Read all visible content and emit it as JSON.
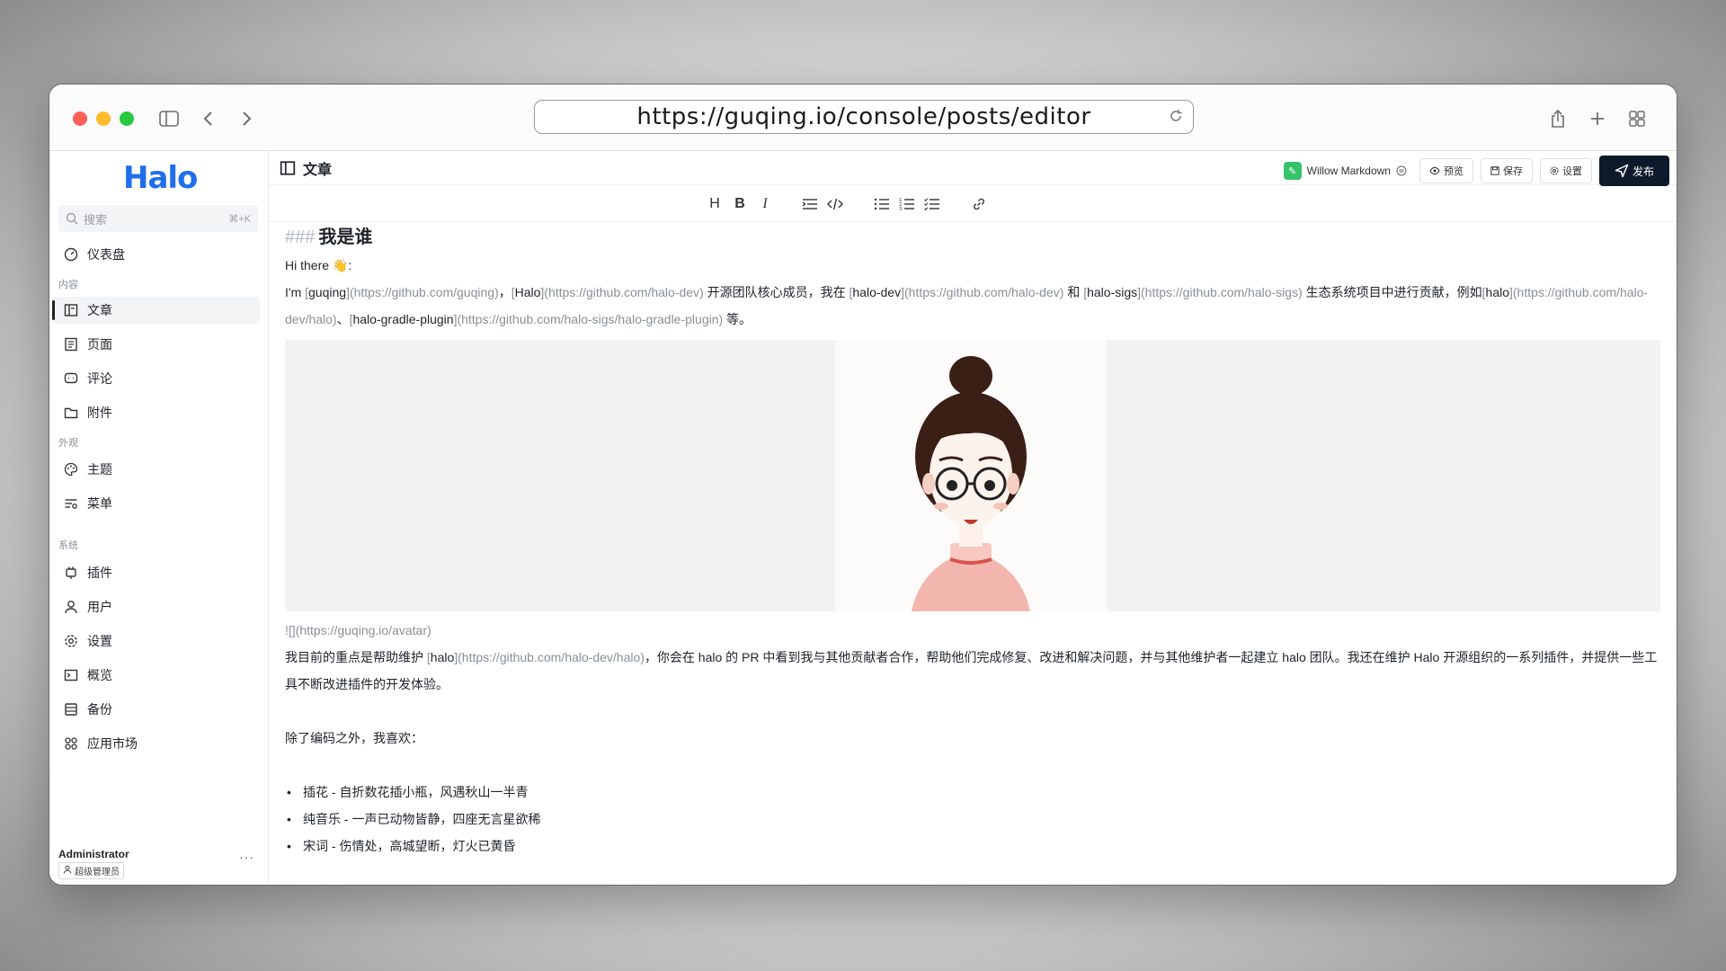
{
  "browser": {
    "url": "https://guqing.io/console/posts/editor"
  },
  "sidebar": {
    "logo": "Halo",
    "search": {
      "placeholder": "搜索",
      "shortcut": "⌘+K"
    },
    "dashboard": "仪表盘",
    "groups": {
      "content": "内容",
      "appearance": "外观",
      "system": "系统"
    },
    "items": {
      "posts": "文章",
      "pages": "页面",
      "comments": "评论",
      "attachments": "附件",
      "themes": "主题",
      "menus": "菜单",
      "plugins": "插件",
      "users": "用户",
      "settings": "设置",
      "overview": "概览",
      "backup": "备份",
      "appstore": "应用市场"
    },
    "user": {
      "name": "Administrator",
      "role": "超级管理员"
    }
  },
  "header": {
    "title": "文章",
    "editor_name": "Willow Markdown",
    "preview": "预览",
    "save": "保存",
    "settings": "设置",
    "publish": "发布"
  },
  "toolbar": {
    "heading": "H",
    "bold": "B",
    "italic": "I"
  },
  "document": {
    "h3_marker": "###",
    "h3_text": "我是谁",
    "greeting": "Hi there 👋:",
    "intro": {
      "p1": "I'm ",
      "guqing": "guqing",
      "guqing_url": "(https://github.com/guqing)",
      "sep1": "，",
      "halo": "Halo",
      "halo_url": "(https://github.com/halo-dev)",
      "p2": " 开源团队核心成员，我在 ",
      "halodev": "halo-dev",
      "halodev_url": "(https://github.com/halo-dev)",
      "p3": " 和 ",
      "halosigs": "halo-sigs",
      "halosigs_url": "(https://github.com/halo-sigs)",
      "p4": " 生态系统项目中进行贡献，例如",
      "halo2": "halo",
      "halo2_url": "(https://github.com/halo-dev/halo)",
      "p5": "、",
      "gradle": "halo-gradle-plugin",
      "gradle_url": "(https://github.com/halo-sigs/halo-gradle-plugin)",
      "p6": " 等。"
    },
    "image_md": "![](https://guqing.io/avatar)",
    "focus": {
      "p1": "我目前的重点是帮助维护 ",
      "halo": "halo",
      "halo_url": "(https://github.com/halo-dev/halo)",
      "p2": "，你会在 halo 的 PR 中看到我与其他贡献者合作，帮助他们完成修复、改进和解决问题，并与其他维护者一起建立 halo 团队。我还在维护 Halo 开源组织的一系列插件，并提供一些工具不断改进插件的开发体验。"
    },
    "likes_intro": "除了编码之外，我喜欢：",
    "likes": [
      "插花 - 自折数花插小瓶，风遇秋山一半青",
      "纯音乐 - 一声已动物皆静，四座无言星欲稀",
      "宋词 - 伤情处，高城望断，灯火已黄昏"
    ]
  }
}
